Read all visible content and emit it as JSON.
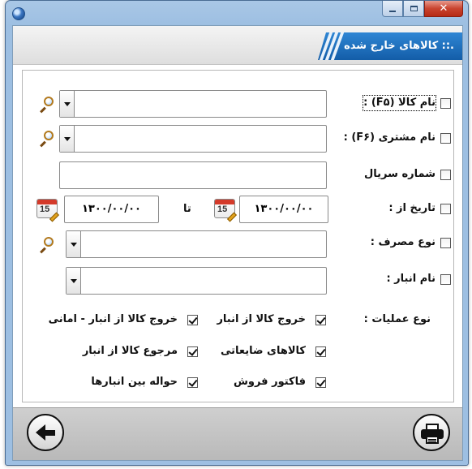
{
  "window": {
    "title_text": "",
    "form_title": ".:: کالاهای خارج شده"
  },
  "fields": {
    "product_name_label": "نام کالا (F۵) :",
    "customer_name_label": "نام مشتری (F۶) :",
    "serial_label": "شماره سریال",
    "date_from_label": "تاریخ از :",
    "date_to_label": "تا",
    "consumption_type_label": "نوع مصرف :",
    "warehouse_label": "نام انبار :",
    "date_from_value": "۱۳۰۰/۰۰/۰۰",
    "date_to_value": "۱۳۰۰/۰۰/۰۰",
    "calendar_day": "15"
  },
  "operations": {
    "label": "نوع عملیات :",
    "items": [
      {
        "label": "خروج کالا از انبار",
        "checked": true
      },
      {
        "label": "خروج کالا از انبار - امانی",
        "checked": true
      },
      {
        "label": "کالاهای ضایعاتی",
        "checked": true
      },
      {
        "label": "مرجوع کالا از انبار",
        "checked": true
      },
      {
        "label": "فاکتور فروش",
        "checked": true
      },
      {
        "label": "حواله بین انبارها",
        "checked": true
      }
    ]
  },
  "icons": {
    "search": "search-icon",
    "calendar": "calendar-icon",
    "back": "back-arrow-icon",
    "print": "printer-icon"
  },
  "colors": {
    "title_ribbon": "#1f6fbf",
    "window_frame": "#9dbfe2",
    "close_button": "#c9442f"
  }
}
